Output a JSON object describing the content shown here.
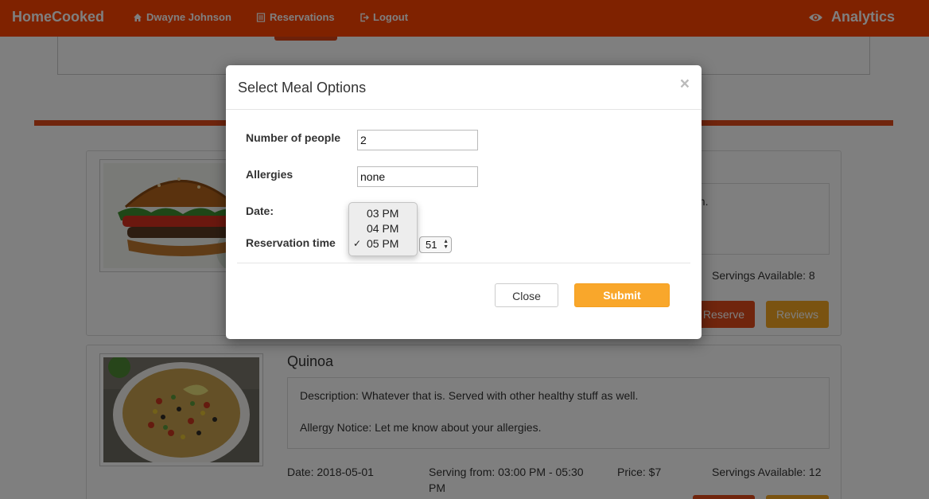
{
  "navbar": {
    "brand": "HomeCooked",
    "user_label": "Dwayne Johnson",
    "reservations_label": "Reservations",
    "logout_label": "Logout",
    "analytics_label": "Analytics"
  },
  "meals": [
    {
      "title": "",
      "description_fragment": "on.",
      "servings": "Servings Available: 8",
      "reserve_label": "Reserve",
      "reviews_label": "Reviews",
      "image": "burger-photo"
    },
    {
      "title": "Quinoa",
      "description": "Description: Whatever that is. Served with other healthy stuff as well.",
      "allergy_notice": "Allergy Notice: Let me know about your allergies.",
      "date": "Date: 2018-05-01",
      "serving_from": "Serving from: 03:00 PM - 05:30",
      "serving_to": "PM",
      "price": "Price: $7",
      "servings": "Servings Available: 12",
      "image": "quinoa-salad-photo"
    }
  ],
  "modal": {
    "title": "Select Meal Options",
    "close_icon": "×",
    "people_label": "Number of people",
    "people_value": "2",
    "allergies_label": "Allergies",
    "allergies_value": "none",
    "date_label": "Date:",
    "time_label": "Reservation time",
    "hour_options": [
      "03 PM",
      "04 PM",
      "05 PM"
    ],
    "selected_hour": "05 PM",
    "minute_value": "51",
    "close_button": "Close",
    "submit_button": "Submit"
  },
  "colors": {
    "navbar": "#ff4500",
    "reserve": "#e04a1a",
    "reviews": "#f5a623",
    "submit": "#f9a72b"
  }
}
